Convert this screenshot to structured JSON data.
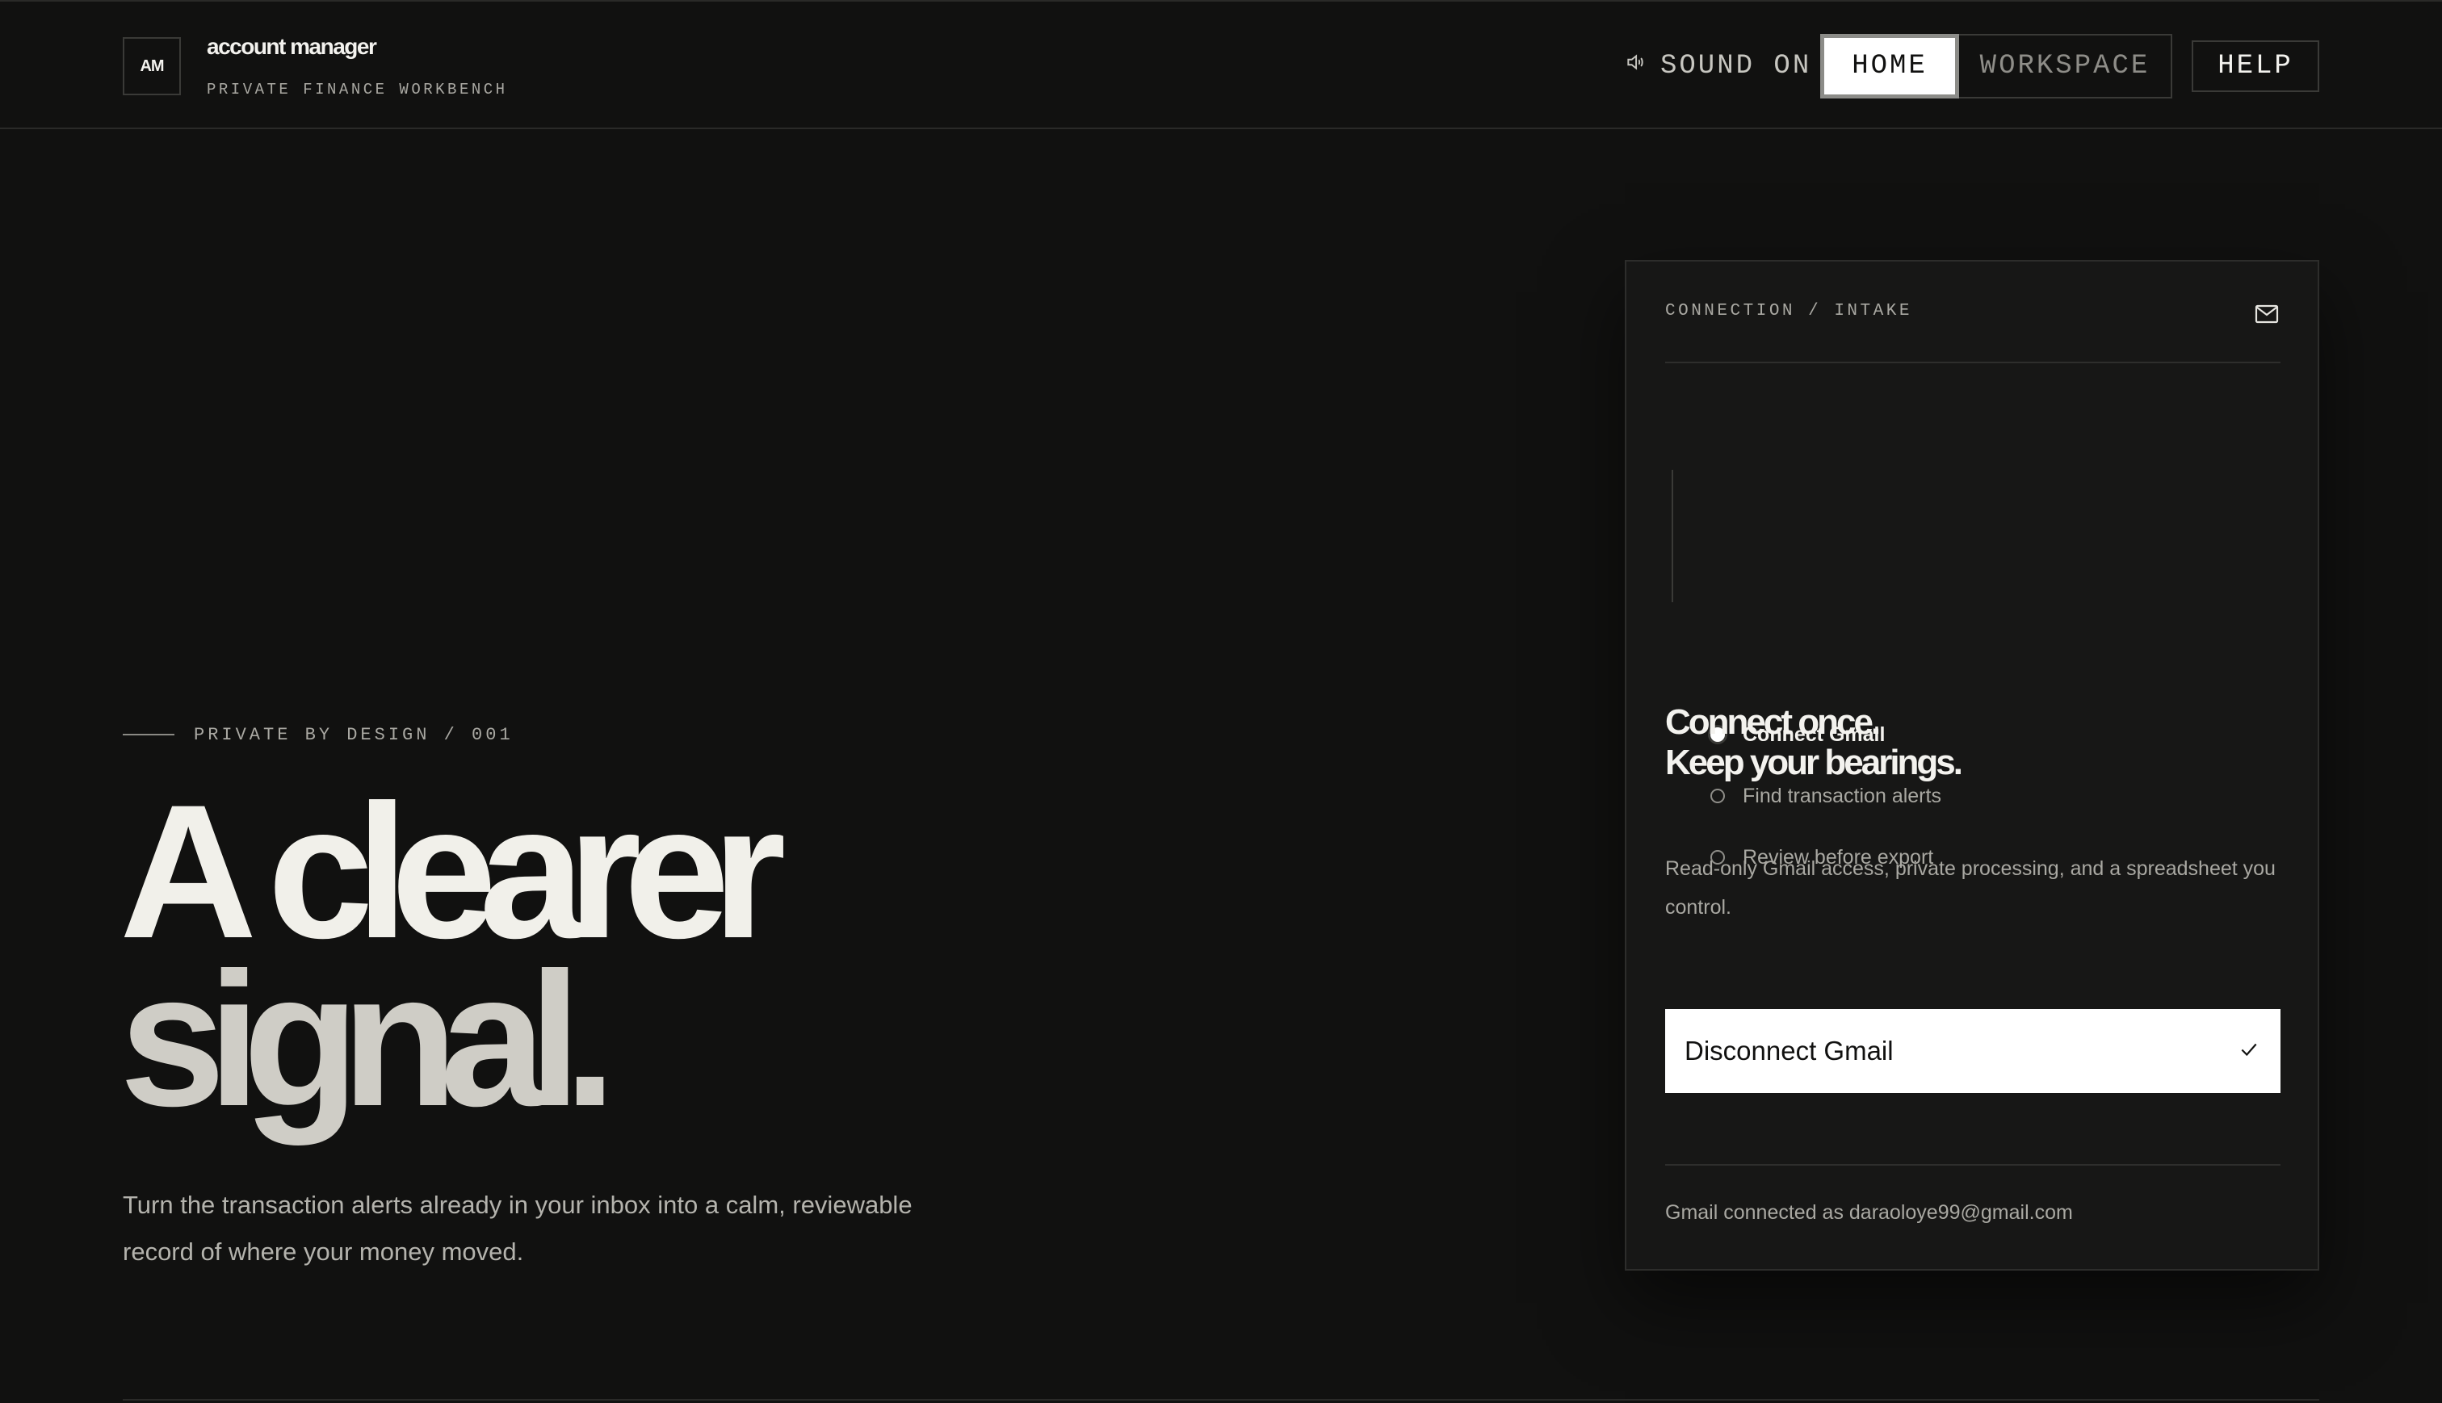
{
  "header": {
    "logo_mark": "AM",
    "app_name": "account manager",
    "app_subtitle": "PRIVATE FINANCE WORKBENCH",
    "sound_label": "SOUND ON",
    "sound_icon": "speaker-icon",
    "nav": {
      "home": "HOME",
      "workspace": "WORKSPACE",
      "active": "HOME"
    },
    "help": "HELP"
  },
  "hero": {
    "eyebrow": "PRIVATE BY DESIGN / 001",
    "headline_line1": "A clearer",
    "headline_line2": "signal.",
    "body": "Turn the transaction alerts already in your inbox into a calm, reviewable record of where your money moved."
  },
  "card": {
    "label": "CONNECTION / INTAKE",
    "icon": "mail-icon",
    "steps": [
      {
        "label": "Connect Gmail",
        "active": true
      },
      {
        "label": "Find transaction alerts",
        "active": false
      },
      {
        "label": "Review before export",
        "active": false
      }
    ],
    "title_line1": "Connect once.",
    "title_line2": "Keep your bearings.",
    "body": "Read-only Gmail access, private processing, and a spreadsheet you control.",
    "cta_label": "Disconnect Gmail",
    "cta_icon": "check-icon",
    "status": "Gmail connected as daraoloye99@gmail.com"
  },
  "colors": {
    "background": "#111110",
    "card": "#171716",
    "text_primary": "#f3f2ee",
    "text_muted": "#a9a8a2",
    "cta_bg": "#ffffff"
  }
}
